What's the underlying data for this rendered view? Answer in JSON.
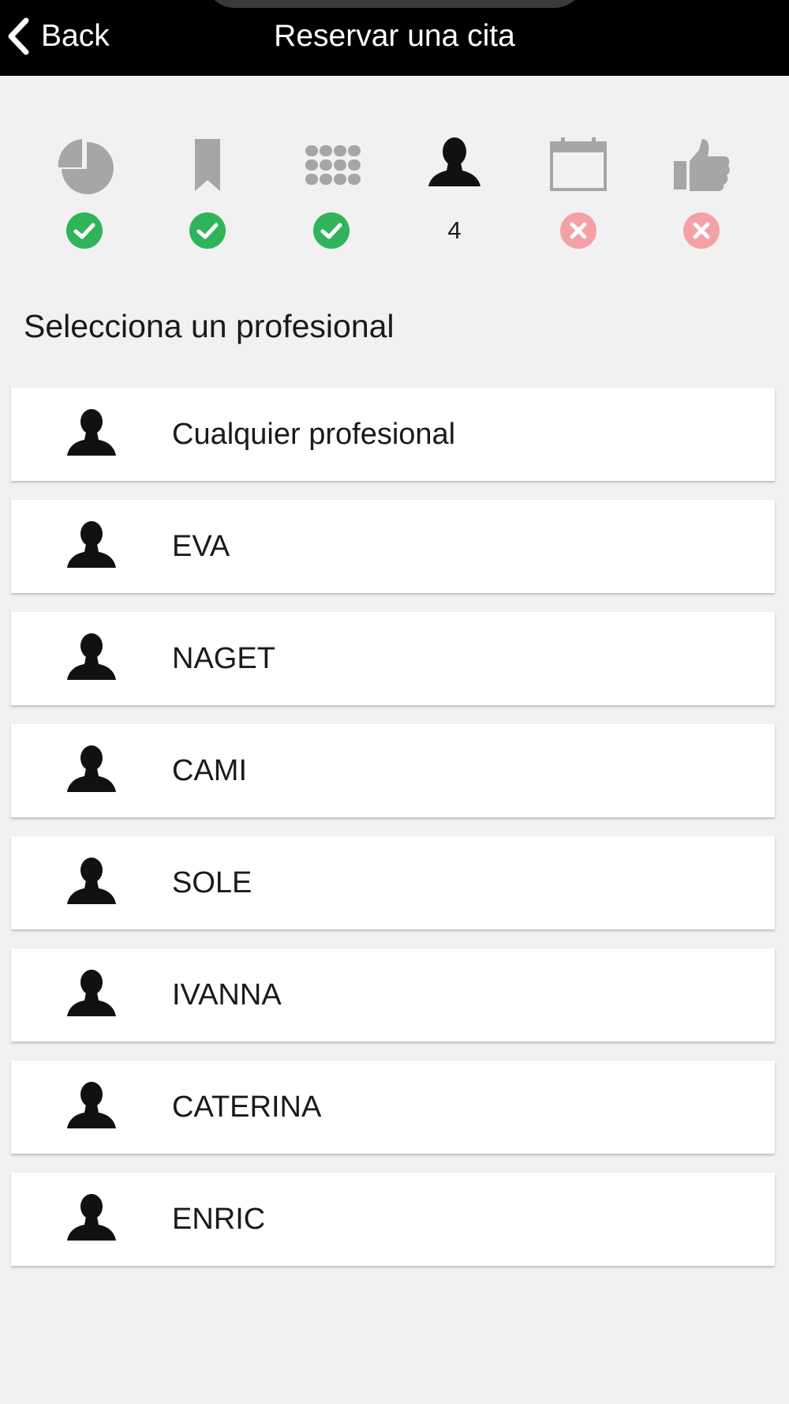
{
  "header": {
    "back_label": "Back",
    "back_icon": "chevron-left-icon",
    "title": "Reservar una cita"
  },
  "steps": [
    {
      "icon": "pie-chart-icon",
      "status": "done"
    },
    {
      "icon": "bookmark-icon",
      "status": "done"
    },
    {
      "icon": "grid-dots-icon",
      "status": "done"
    },
    {
      "icon": "person-icon",
      "status": "current",
      "number": "4"
    },
    {
      "icon": "calendar-icon",
      "status": "pending"
    },
    {
      "icon": "thumbs-up-icon",
      "status": "pending"
    }
  ],
  "section_title": "Selecciona un profesional",
  "professionals": [
    {
      "name": "Cualquier profesional",
      "icon": "person-icon"
    },
    {
      "name": "EVA",
      "icon": "person-icon"
    },
    {
      "name": "NAGET",
      "icon": "person-icon"
    },
    {
      "name": "CAMI",
      "icon": "person-icon"
    },
    {
      "name": "SOLE",
      "icon": "person-icon"
    },
    {
      "name": "IVANNA",
      "icon": "person-icon"
    },
    {
      "name": "CATERINA",
      "icon": "person-icon"
    },
    {
      "name": "ENRIC",
      "icon": "person-icon"
    }
  ],
  "colors": {
    "header_bg": "#000000",
    "page_bg": "#f1f1f1",
    "done": "#2fb45a",
    "pending": "#f4a1a6",
    "step_inactive": "#a6a6a6",
    "step_active": "#111111"
  }
}
